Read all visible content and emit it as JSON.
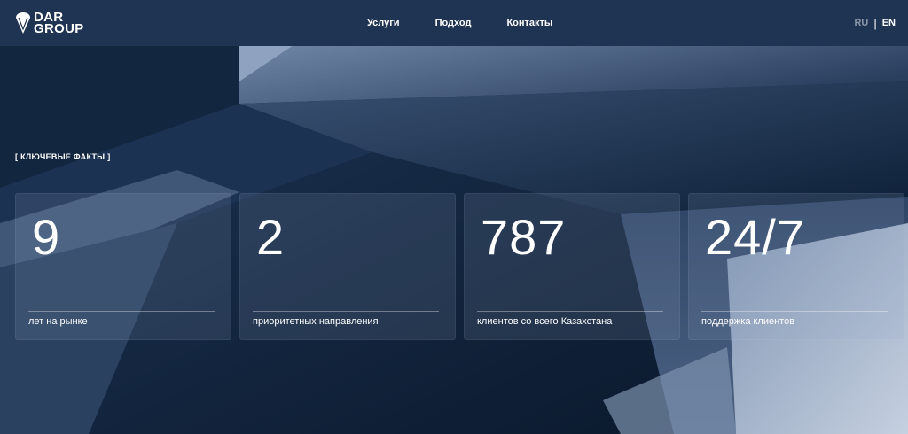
{
  "brand": {
    "line1": "DAR",
    "line2": "GROUP"
  },
  "nav": {
    "items": [
      {
        "label": "Услуги"
      },
      {
        "label": "Подход"
      },
      {
        "label": "Контакты"
      }
    ]
  },
  "lang": {
    "ru": "RU",
    "separator": "|",
    "en": "EN",
    "active": "EN"
  },
  "facts": {
    "section_label": "[ КЛЮЧЕВЫЕ ФАКТЫ ]",
    "cards": [
      {
        "value": "9",
        "caption": "лет на рынке"
      },
      {
        "value": "2",
        "caption": "приоритетных направления"
      },
      {
        "value": "787",
        "caption": "клиентов со всего Казахстана"
      },
      {
        "value": "24/7",
        "caption": "поддержка клиентов"
      }
    ]
  },
  "colors": {
    "header_bg": "#1f3453",
    "hero_dark": "#0f223b",
    "hero_light": "#a9b8cf",
    "text": "#ffffff",
    "lang_inactive": "#8a96a8"
  },
  "icons": {
    "logo": "ice-cream-cone-logo-icon"
  }
}
